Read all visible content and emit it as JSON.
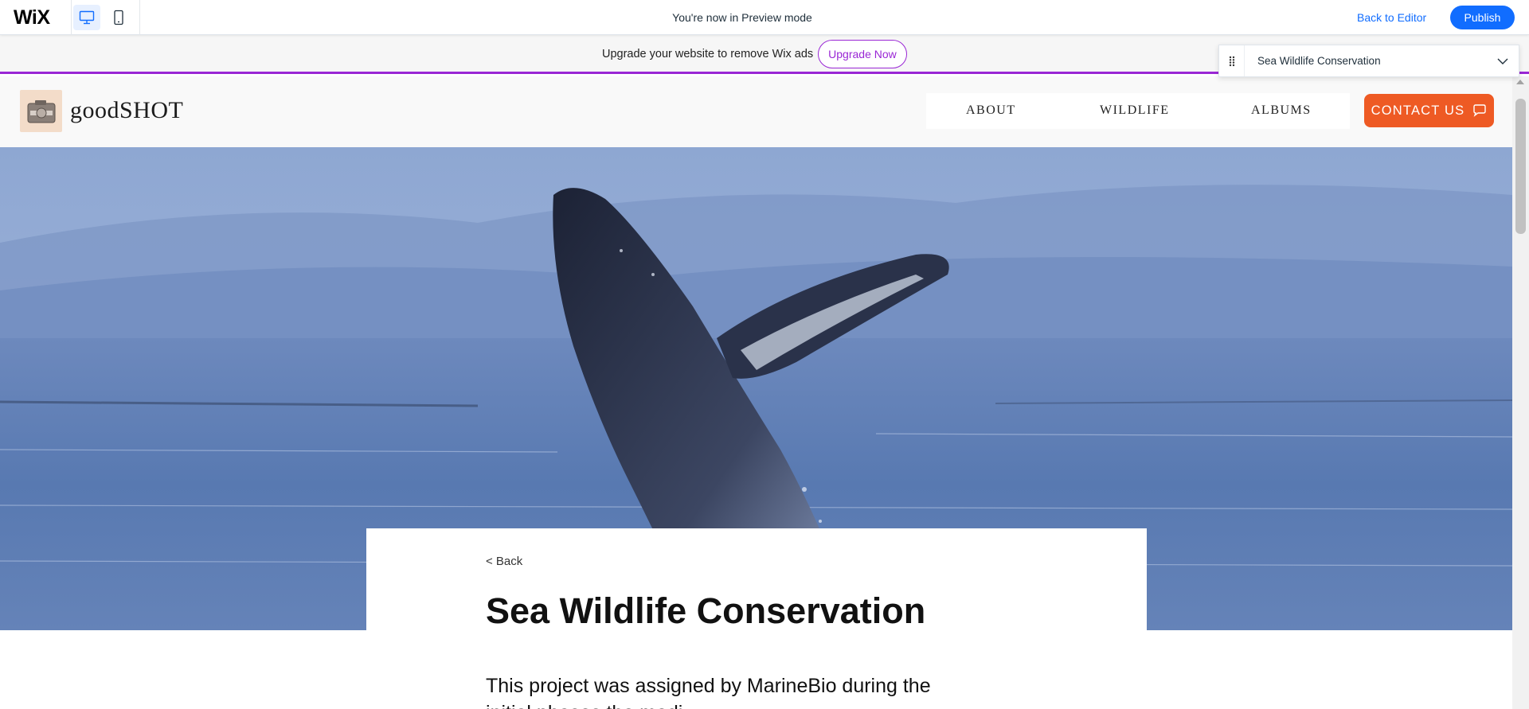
{
  "wix_bar": {
    "logo": "WiX",
    "preview_message": "You're now in Preview mode",
    "back_to_editor": "Back to Editor",
    "publish": "Publish",
    "devices": [
      "desktop-icon",
      "mobile-icon"
    ],
    "active_device": "desktop",
    "accent_color": "#116dff"
  },
  "upgrade_banner": {
    "text": "Upgrade your website to remove Wix ads",
    "button": "Upgrade Now",
    "accent_color": "#9a27d5"
  },
  "page_selector": {
    "selected": "Sea Wildlife Conservation"
  },
  "site": {
    "logo_text": "goodSHOT",
    "nav": [
      "ABOUT",
      "WILDLIFE",
      "ALBUMS"
    ],
    "contact_button": "CONTACT US",
    "contact_color": "#ee5a24"
  },
  "post": {
    "back_link": "< Back",
    "title": "Sea Wildlife Conservation",
    "body_line_1": "This project was assigned by MarineBio during the",
    "body_line_2": "initial phases the medi"
  }
}
